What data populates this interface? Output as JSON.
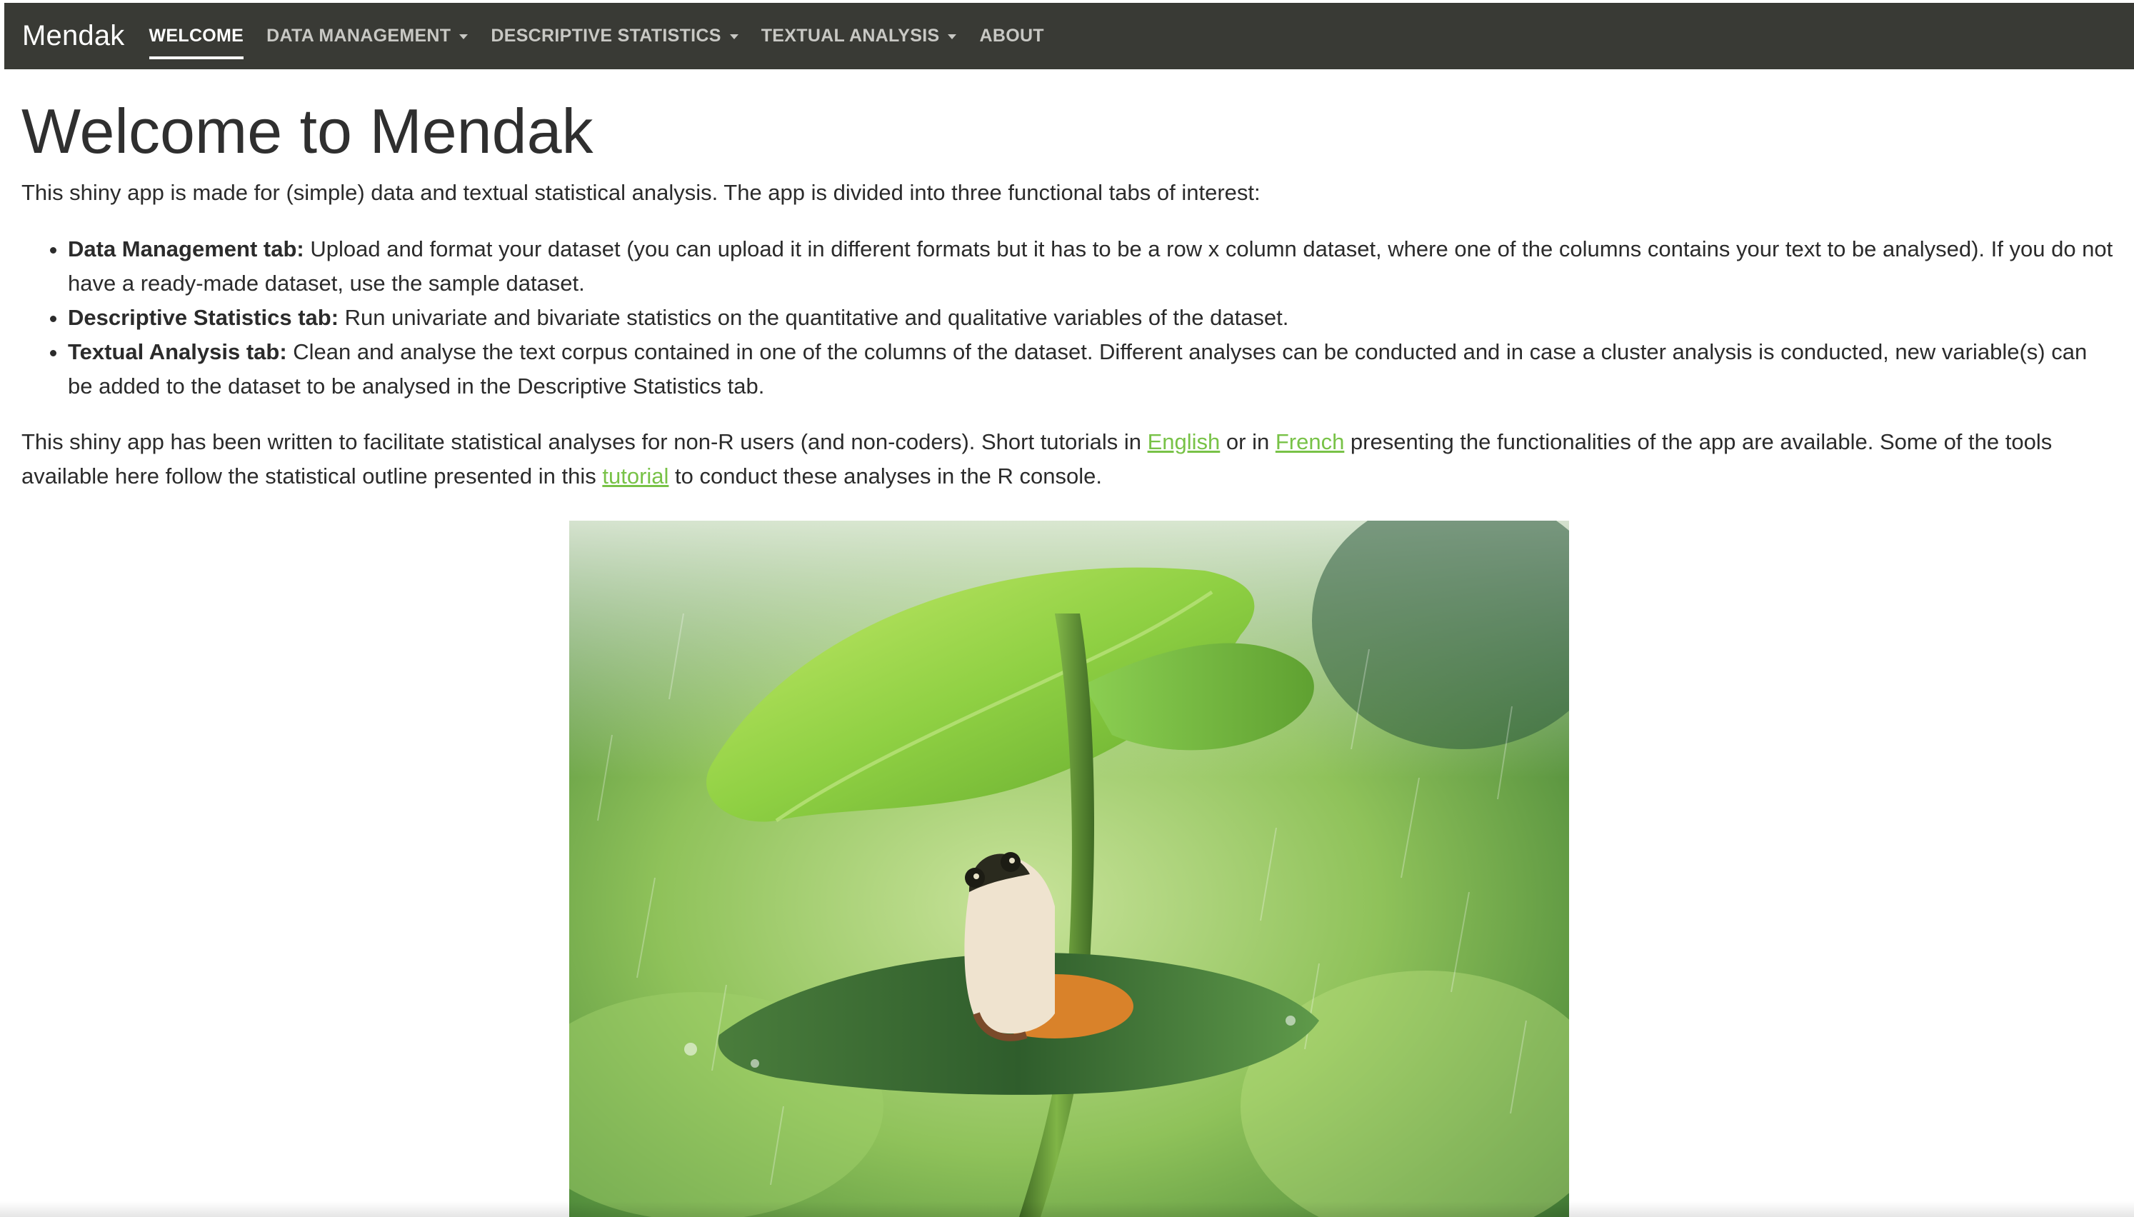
{
  "navbar": {
    "brand": "Mendak",
    "items": [
      {
        "label": "WELCOME",
        "active": true,
        "dropdown": false
      },
      {
        "label": "DATA MANAGEMENT",
        "active": false,
        "dropdown": true
      },
      {
        "label": "DESCRIPTIVE STATISTICS",
        "active": false,
        "dropdown": true
      },
      {
        "label": "TEXTUAL ANALYSIS",
        "active": false,
        "dropdown": true
      },
      {
        "label": "ABOUT",
        "active": false,
        "dropdown": false
      }
    ]
  },
  "main": {
    "title": "Welcome to Mendak",
    "intro": "This shiny app is made for (simple) data and textual statistical analysis. The app is divided into three functional tabs of interest:",
    "tabs": [
      {
        "name": "Data Management tab:",
        "desc": " Upload and format your dataset (you can upload it in different formats but it has to be a row x column dataset, where one of the columns contains your text to be analysed). If you do not have a ready-made dataset, use the sample dataset."
      },
      {
        "name": "Descriptive Statistics tab:",
        "desc": " Run univariate and bivariate statistics on the quantitative and qualitative variables of the dataset."
      },
      {
        "name": "Textual Analysis tab:",
        "desc": " Clean and analyse the text corpus contained in one of the columns of the dataset. Different analyses can be conducted and in case a cluster analysis is conducted, new variable(s) can be added to the dataset to be analysed in the Descriptive Statistics tab."
      }
    ],
    "outro": {
      "part1": "This shiny app has been written to facilitate statistical analyses for non-R users (and non-coders). Short tutorials in ",
      "link_english": "English",
      "part2": " or in ",
      "link_french": "French",
      "part3": " presenting the functionalities of the app are available. Some of the tools available here follow the statistical outline presented in this ",
      "link_tutorial": "tutorial",
      "part4": " to conduct these analyses in the R console."
    }
  },
  "colors": {
    "navbar_bg": "#393a35",
    "link": "#78c247"
  },
  "image": {
    "icon": "frog-under-leaf-in-rain-photo"
  }
}
